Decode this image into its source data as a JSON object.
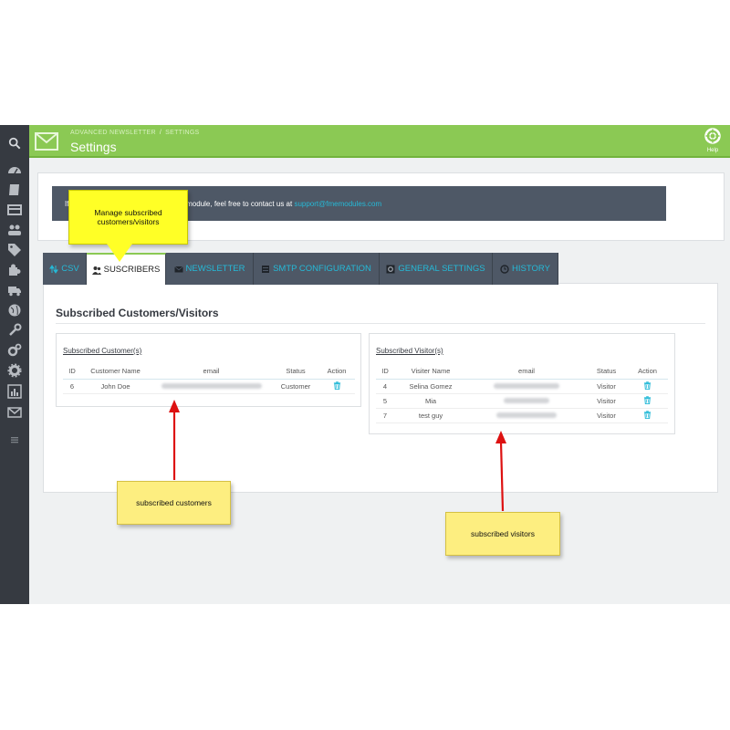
{
  "header": {
    "breadcrumb": [
      "ADVANCED NEWSLETTER",
      "SETTINGS"
    ],
    "breadcrumb_sep": "/",
    "title": "Settings",
    "help_label": "Help",
    "accent": "#8bc954"
  },
  "sidebar": {
    "items": [
      "search-icon",
      "dashboard-icon",
      "orders-icon",
      "catalog-icon",
      "customers-icon",
      "tags-icon",
      "modules-icon",
      "shipping-icon",
      "localization-icon",
      "tools-icon",
      "advanced-icon",
      "settings-icon",
      "stats-icon",
      "newsletter-icon",
      "menu-collapse-icon"
    ]
  },
  "info": {
    "prefix": "If",
    "text": "s module, feel free to contact us at",
    "email": "support@fmemodules.com"
  },
  "tabs": [
    {
      "label": "CSV",
      "icon": "sort-icon"
    },
    {
      "label": "SUSCRIBERS",
      "icon": "users-icon"
    },
    {
      "label": "NEWSLETTER",
      "icon": "envelope-icon"
    },
    {
      "label": "SMTP CONFIGURATION",
      "icon": "server-icon"
    },
    {
      "label": "GENERAL SETTINGS",
      "icon": "cog-icon"
    },
    {
      "label": "HISTORY",
      "icon": "clock-icon"
    }
  ],
  "section_title": "Subscribed Customers/Visitors",
  "customers": {
    "title": "Subscribed Customer(s)",
    "columns": [
      "ID",
      "Customer Name",
      "email",
      "Status",
      "Action"
    ],
    "rows": [
      {
        "id": "6",
        "name": "John Doe",
        "status": "Customer"
      }
    ]
  },
  "visitors": {
    "title": "Subscribed Visitor(s)",
    "columns": [
      "ID",
      "Visiter Name",
      "email",
      "Status",
      "Action"
    ],
    "rows": [
      {
        "id": "4",
        "name": "Selina Gomez",
        "status": "Visitor"
      },
      {
        "id": "5",
        "name": "Mia",
        "status": "Visitor"
      },
      {
        "id": "7",
        "name": "test guy",
        "status": "Visitor"
      }
    ]
  },
  "callouts": {
    "manage": "Manage subscribed customers/visitors",
    "customers": "subscribed customers",
    "visitors": "subscribed visitors"
  }
}
